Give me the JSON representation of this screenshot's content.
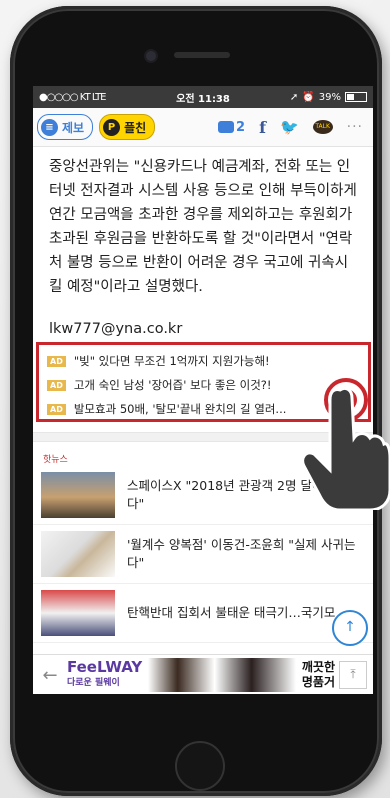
{
  "status_bar": {
    "carrier": "●○○○○ KT  LTE",
    "time": "오전 11:38",
    "battery": "39%"
  },
  "toolbar": {
    "report_label": "제보",
    "follow_label": "플친",
    "comment_count": "2",
    "more_label": "···",
    "talk_label": "TALK"
  },
  "article": {
    "body": "중앙선관위는 \"신용카드나 예금계좌, 전화 또는 인터넷 전자결과 시스템 사용 등으로 인해 부득이하게 연간 모금액을 초과한 경우를 제외하고는 후원회가 초과된 후원금을 반환하도록 할 것\"이라면서 \"연락처 불명 등으로 반환이 어려운 경우 국고에 귀속시킬 예정\"이라고 설명했다.",
    "email": "lkw777@yna.co.kr"
  },
  "ads": {
    "badge": "AD",
    "items": [
      {
        "text": "\"빚\" 있다면 무조건 1억까지 지원가능해!"
      },
      {
        "text": "고개 숙인 남성 '장어즙' 보다 좋은 이것?!"
      },
      {
        "text": "발모효과 50배, '탈모'끝내 완치의 길 열려..."
      }
    ]
  },
  "hot_news": {
    "label": "핫뉴스",
    "items": [
      {
        "title": "스페이스X \"2018년 관광객 2명 달에 보낸다\""
      },
      {
        "title": "'월계수 양복점' 이동건-조윤희 \"실제 사귀는다\""
      },
      {
        "title": "탄핵반대 집회서 불태운 태극기…국기모"
      }
    ]
  },
  "banner": {
    "brand": "FeeLWAY",
    "brand_sub": "다로운 필웨이",
    "text_line1": "깨끗한",
    "text_line2": "명품거"
  },
  "icons": {
    "comment": "comment-icon",
    "facebook": "facebook-icon",
    "twitter": "twitter-icon",
    "kakaotalk": "kakaotalk-icon",
    "scroll_top": "arrow-up-icon"
  }
}
